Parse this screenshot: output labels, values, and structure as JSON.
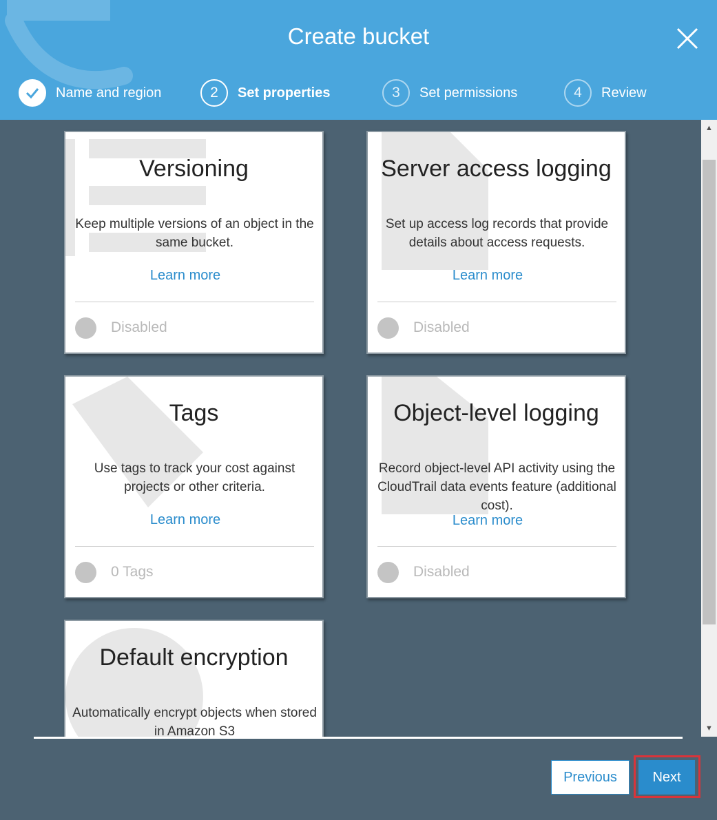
{
  "header": {
    "title": "Create bucket",
    "close_icon": "close-icon"
  },
  "steps": [
    {
      "number": "",
      "label": "Name and region",
      "state": "done"
    },
    {
      "number": "2",
      "label": "Set properties",
      "state": "active"
    },
    {
      "number": "3",
      "label": "Set permissions",
      "state": "pending"
    },
    {
      "number": "4",
      "label": "Review",
      "state": "pending"
    }
  ],
  "cards": {
    "versioning": {
      "title": "Versioning",
      "description": "Keep multiple versions of an object in the same bucket.",
      "link": "Learn more",
      "status": "Disabled"
    },
    "server_access_logging": {
      "title": "Server access logging",
      "description": "Set up access log records that provide details about access requests.",
      "link": "Learn more",
      "status": "Disabled"
    },
    "tags": {
      "title": "Tags",
      "description": "Use tags to track your cost against projects or other criteria.",
      "link": "Learn more",
      "status": "0 Tags"
    },
    "object_level_logging": {
      "title": "Object-level logging",
      "description": "Record object-level API activity using the CloudTrail data events feature (additional cost).",
      "link": "Learn more",
      "status": "Disabled"
    },
    "default_encryption": {
      "title": "Default encryption",
      "description": "Automatically encrypt objects when stored in Amazon S3"
    }
  },
  "footer": {
    "previous_label": "Previous",
    "next_label": "Next"
  },
  "colors": {
    "header_bg": "#4aa6dd",
    "body_bg": "#4c6272",
    "link": "#2a8ccc",
    "primary_button": "#2a8ccc",
    "highlight": "#d9343a"
  }
}
